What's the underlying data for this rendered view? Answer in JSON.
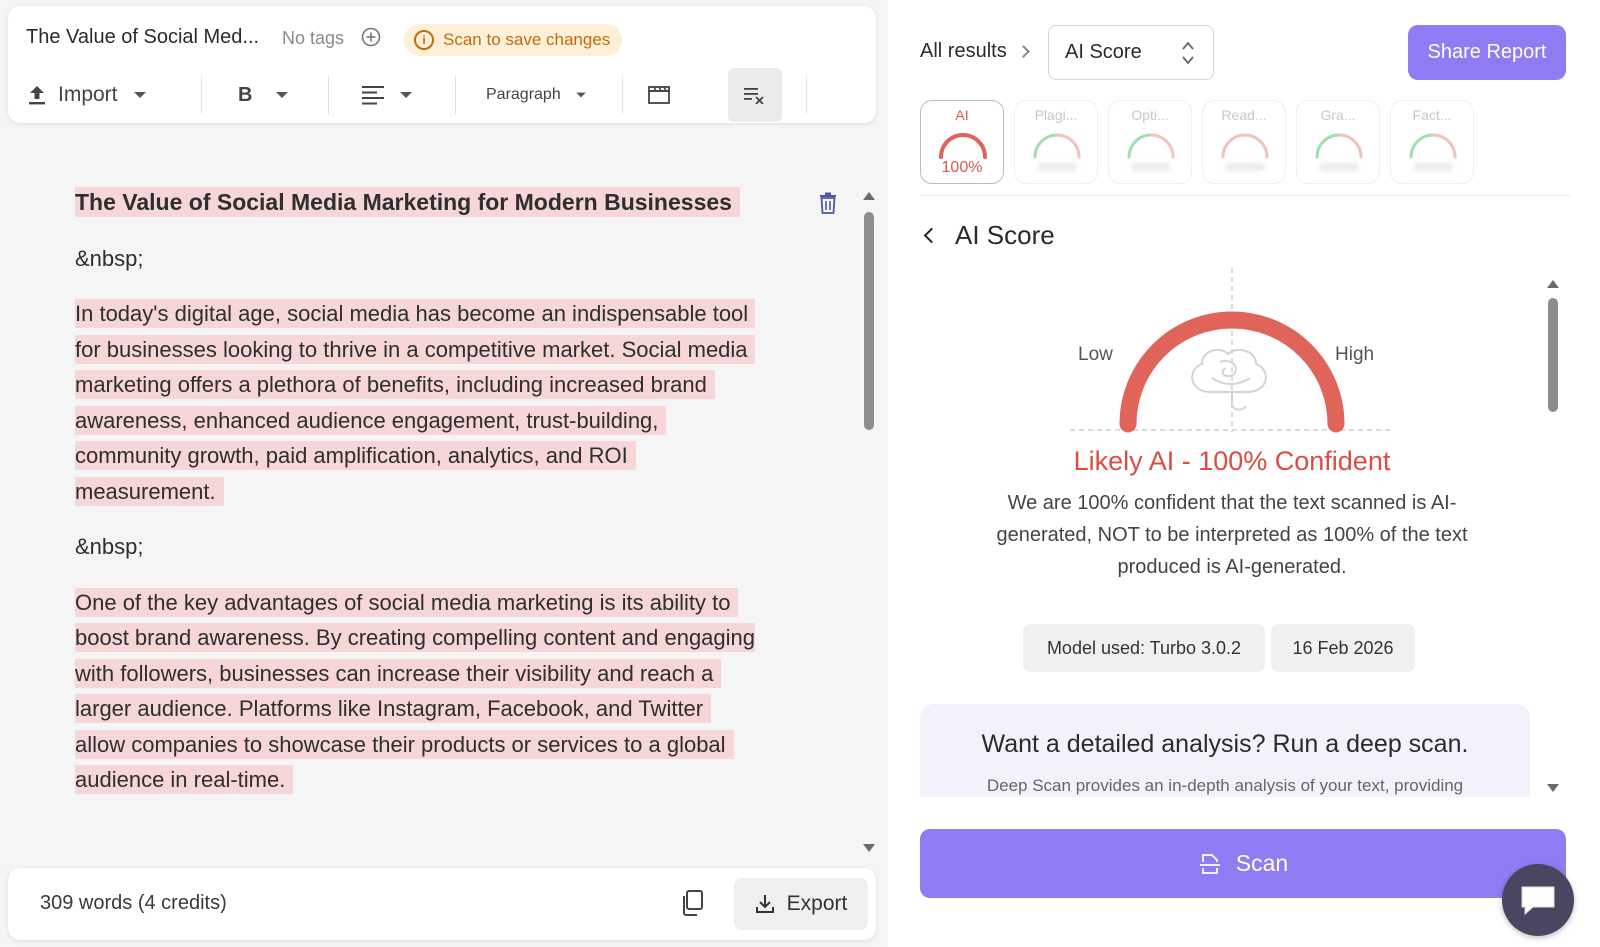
{
  "editor_header": {
    "doc_title": "The Value of Social Med...",
    "tags_label": "No tags",
    "scan_notice": "Scan to save changes"
  },
  "toolbar": {
    "import_label": "Import",
    "bold_label": "B",
    "paragraph_label": "Paragraph"
  },
  "document": {
    "heading": "The Value of Social Media Marketing for Modern Businesses",
    "spacer_1": "&nbsp;",
    "paragraph_1": "In today's digital age, social media has become an indispensable tool for businesses looking to thrive in a competitive market. Social media marketing offers a plethora of benefits, including increased brand awareness, enhanced audience engagement, trust-building, community growth, paid amplification, analytics, and ROI measurement.",
    "spacer_2": "&nbsp;",
    "paragraph_2": "One of the key advantages of social media marketing is its ability to boost brand awareness. By creating compelling content and engaging with followers, businesses can increase their visibility and reach a larger audience. Platforms like Instagram, Facebook, and Twitter allow companies to showcase their products or services to a global audience in real-time."
  },
  "footer": {
    "word_count": "309 words (4 credits)",
    "export_label": "Export"
  },
  "results": {
    "breadcrumb": "All results",
    "selected_score": "AI Score",
    "share_label": "Share Report",
    "tabs": [
      {
        "label": "AI",
        "value": "100%",
        "active": true
      },
      {
        "label": "Plagi...",
        "value": "",
        "active": false
      },
      {
        "label": "Opti...",
        "value": "",
        "active": false
      },
      {
        "label": "Read...",
        "value": "",
        "active": false
      },
      {
        "label": "Gra...",
        "value": "",
        "active": false
      },
      {
        "label": "Fact...",
        "value": "",
        "active": false
      }
    ],
    "section_title": "AI Score",
    "gauge": {
      "low_label": "Low",
      "high_label": "High",
      "confidence": 100,
      "color": "#e0645a"
    },
    "verdict": "Likely AI - 100% Confident",
    "description": "We are 100% confident that the text scanned is AI-generated, NOT to be interpreted as 100% of the text produced is AI-generated.",
    "model_chip": "Model used: Turbo 3.0.2",
    "date_chip": "16 Feb 2026",
    "deep_scan_title": "Want a detailed analysis? Run a deep scan.",
    "deep_scan_sub": "Deep Scan provides an in-depth analysis of your text, providing",
    "scan_label": "Scan"
  },
  "colors": {
    "accent": "#8f7cf5",
    "ai_red": "#dd4c40",
    "highlight": "#f6d6d6",
    "warning": "#c56a0b"
  }
}
